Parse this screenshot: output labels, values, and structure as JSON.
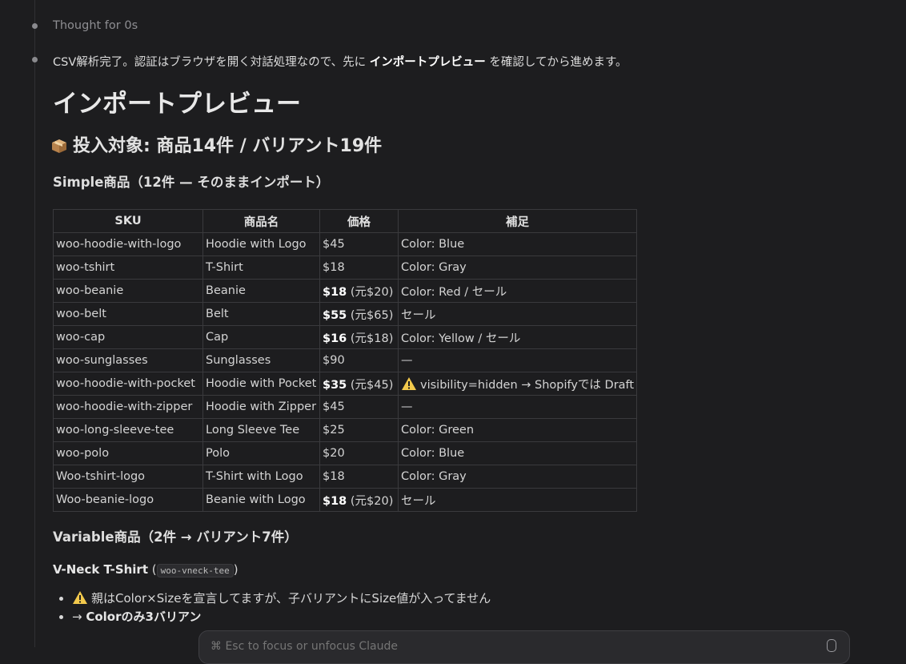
{
  "steps": {
    "thought": "Thought for 0s",
    "status_pre": "CSV解析完了。認証はブラウザを開く対話処理なので、先に ",
    "status_bold": "インポートプレビュー",
    "status_post": " を確認してから進めます。"
  },
  "preview": {
    "title": "インポートプレビュー",
    "target": "投入対象: 商品14件 / バリアント19件",
    "target_icon": "package-icon",
    "simple_heading": "Simple商品（12件 — そのままインポート）",
    "columns": [
      "SKU",
      "商品名",
      "価格",
      "補足"
    ],
    "rows": [
      {
        "sku": "woo-hoodie-with-logo",
        "name": "Hoodie with Logo",
        "price": "$45",
        "orig": "",
        "note": "Color: Blue",
        "warn": false
      },
      {
        "sku": "woo-tshirt",
        "name": "T-Shirt",
        "price": "$18",
        "orig": "",
        "note": "Color: Gray",
        "warn": false
      },
      {
        "sku": "woo-beanie",
        "name": "Beanie",
        "price": "$18",
        "orig": " (元$20)",
        "note": "Color: Red / セール",
        "warn": false
      },
      {
        "sku": "woo-belt",
        "name": "Belt",
        "price": "$55",
        "orig": " (元$65)",
        "note": "セール",
        "warn": false
      },
      {
        "sku": "woo-cap",
        "name": "Cap",
        "price": "$16",
        "orig": " (元$18)",
        "note": "Color: Yellow / セール",
        "warn": false
      },
      {
        "sku": "woo-sunglasses",
        "name": "Sunglasses",
        "price": "$90",
        "orig": "",
        "note": "—",
        "warn": false
      },
      {
        "sku": "woo-hoodie-with-pocket",
        "name": "Hoodie with Pocket",
        "price": "$35",
        "orig": " (元$45)",
        "note": "visibility=hidden → Shopifyでは Draft",
        "warn": true
      },
      {
        "sku": "woo-hoodie-with-zipper",
        "name": "Hoodie with Zipper",
        "price": "$45",
        "orig": "",
        "note": "—",
        "warn": false
      },
      {
        "sku": "woo-long-sleeve-tee",
        "name": "Long Sleeve Tee",
        "price": "$25",
        "orig": "",
        "note": "Color: Green",
        "warn": false
      },
      {
        "sku": "woo-polo",
        "name": "Polo",
        "price": "$20",
        "orig": "",
        "note": "Color: Blue",
        "warn": false
      },
      {
        "sku": "Woo-tshirt-logo",
        "name": "T-Shirt with Logo",
        "price": "$18",
        "orig": "",
        "note": "Color: Gray",
        "warn": false
      },
      {
        "sku": "Woo-beanie-logo",
        "name": "Beanie with Logo",
        "price": "$18",
        "orig": " (元$20)",
        "note": "セール",
        "warn": false
      }
    ],
    "variable_heading": "Variable商品（2件 → バリアント7件）",
    "vneck_title": "V-Neck T-Shirt",
    "vneck_open": " (",
    "vneck_code": "woo-vneck-tee",
    "vneck_close": ")",
    "bullets": [
      {
        "icon": "warning-icon",
        "text": "親はColor×Sizeを宣言してますが、子バリアントにSize値が入ってません"
      },
      {
        "icon": "",
        "prefix": "→ ",
        "bold": "Colorのみ3バリアン"
      }
    ]
  },
  "input": {
    "placeholder": "⌘ Esc to focus or unfocus Claude"
  }
}
